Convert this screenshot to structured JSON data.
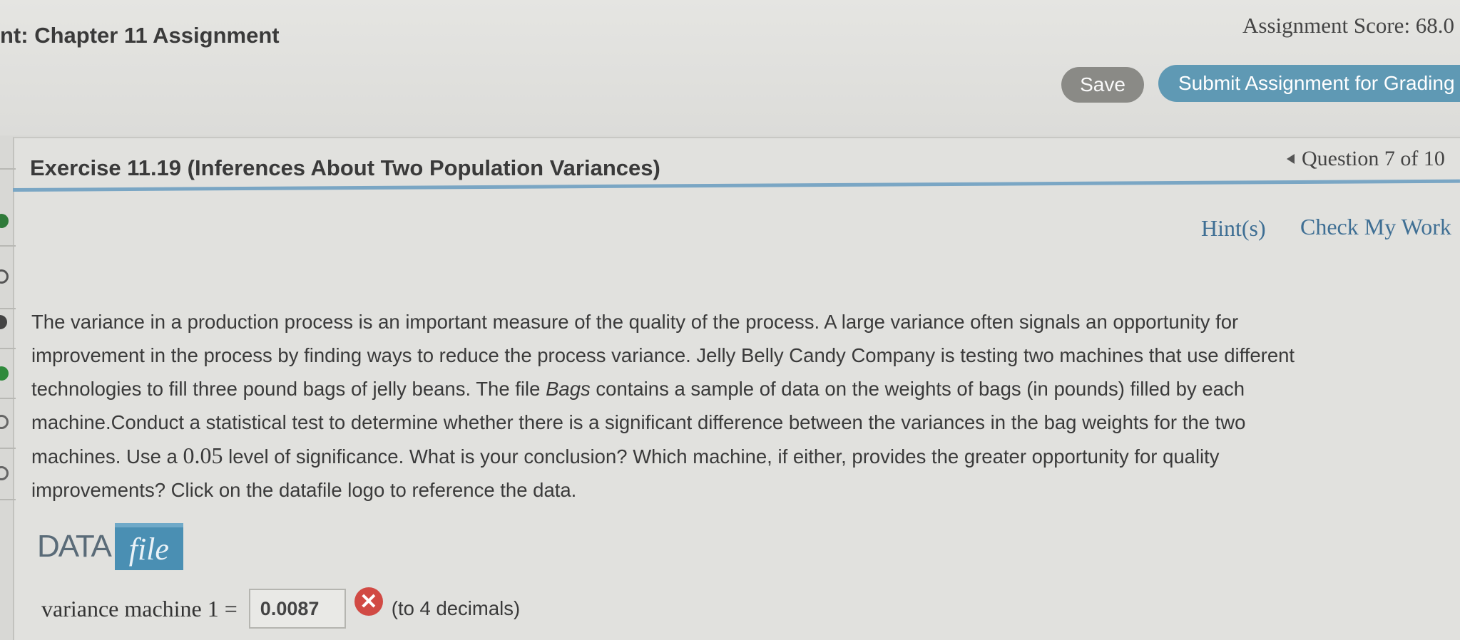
{
  "header": {
    "assignment_title": "nt: Chapter 11 Assignment",
    "score_text": "Assignment Score: 68.0",
    "save_label": "Save",
    "submit_label": "Submit Assignment for Grading"
  },
  "exercise": {
    "title": "Exercise 11.19 (Inferences About Two Population Variances)",
    "question_nav": "Question 7 of 10",
    "hint_label": "Hint(s)",
    "check_label": "Check My Work"
  },
  "question": {
    "lines": [
      "The variance in a production process is an important measure of the quality of the process. A large variance often signals an opportunity for",
      "improvement in the process by finding ways to reduce the process variance. Jelly Belly Candy Company is testing two machines that use different",
      "technologies to fill three pound bags of jelly beans. The file ",
      "Bags",
      " contains a sample of data on the weights of bags (in pounds) filled by each",
      "machine.Conduct a statistical test to determine whether there is a significant difference between the variances in the bag weights for the two",
      "machines. Use a ",
      "0.05",
      " level of significance. What is your conclusion? Which machine, if either, provides the greater opportunity for quality",
      "improvements? Click on the datafile logo to reference the data."
    ]
  },
  "datafile": {
    "data_word": "DATA",
    "file_word": "file"
  },
  "answer": {
    "label": "variance machine 1 =",
    "value": "0.0087",
    "note": "(to 4 decimals)",
    "status": "incorrect"
  },
  "colors": {
    "submit_button": "#5f99b4",
    "save_button": "#8a8a86",
    "link": "#3f6f94",
    "title_rule": "#7aa6c4",
    "error": "#d14a44",
    "correct": "#3a8a3a"
  }
}
